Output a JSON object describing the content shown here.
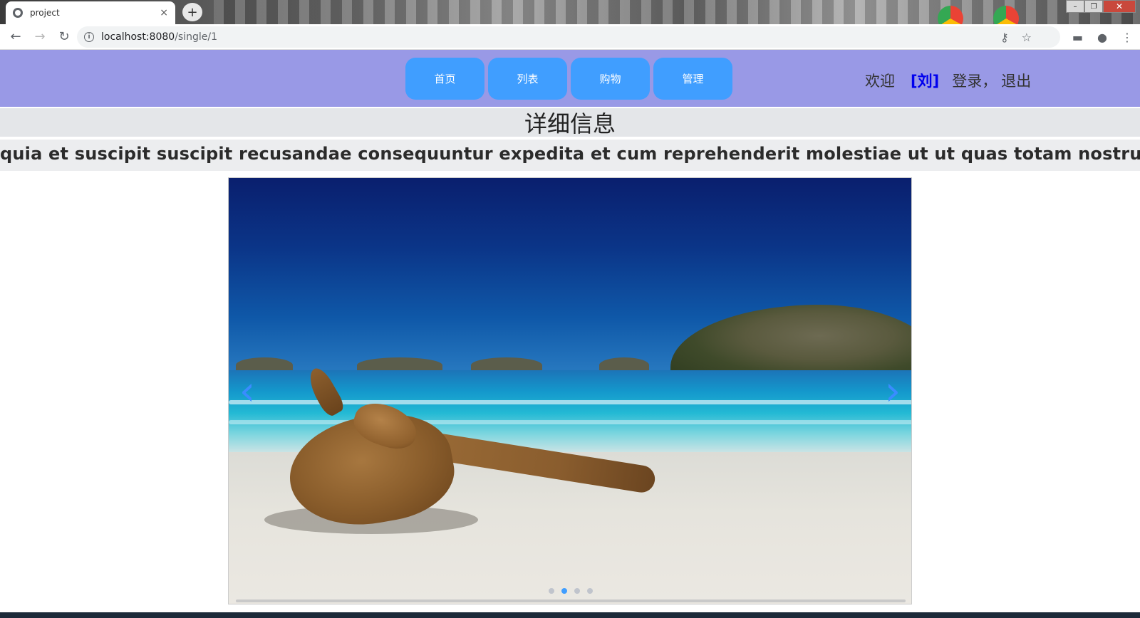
{
  "browser": {
    "tab_title": "project",
    "tab_close": "×",
    "new_tab": "+",
    "url_host": "localhost:8080",
    "url_path": "/single/1",
    "back": "←",
    "forward": "→",
    "reload": "↻",
    "info": "i",
    "key_icon": "⚷",
    "star_icon": "☆",
    "ext_icon": "▬",
    "account_icon": "●",
    "menu_icon": "⋮",
    "min": "–",
    "restore": "❐",
    "close": "✕"
  },
  "nav": {
    "links": [
      "首页",
      "列表",
      "购物",
      "管理"
    ],
    "welcome": "欢迎",
    "username": "[刘]",
    "login": "登录，",
    "logout": "退出"
  },
  "detail": {
    "title": "详细信息",
    "description": "quia et suscipit suscipit recusandae consequuntur expedita et cum reprehenderit molestiae ut ut quas totam nostrum rerum est autem sunt rem eveniet architecto"
  },
  "carousel": {
    "prev": "‹",
    "next": "›",
    "slide_count": 4,
    "active_index": 1
  },
  "colors": {
    "nav_bg": "#9999e6",
    "nav_button": "#409eff",
    "username": "#0000ee",
    "accent": "#409eff"
  }
}
